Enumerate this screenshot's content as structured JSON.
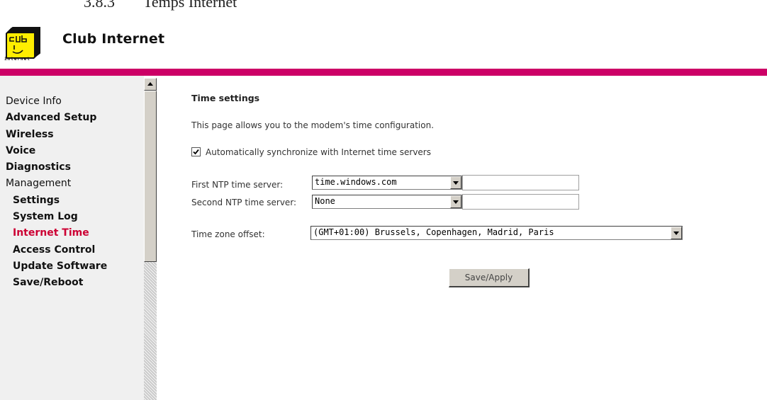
{
  "doc": {
    "section_number": "3.8.3",
    "section_title": "Temps Internet"
  },
  "brand": {
    "name": "Club Internet",
    "logo_small_text": "internet"
  },
  "sidebar": {
    "items": [
      {
        "label": "Device Info",
        "name": "sidebar-item-device-info"
      },
      {
        "label": "Advanced Setup",
        "name": "sidebar-item-advanced-setup"
      },
      {
        "label": "Wireless",
        "name": "sidebar-item-wireless"
      },
      {
        "label": "Voice",
        "name": "sidebar-item-voice"
      },
      {
        "label": "Diagnostics",
        "name": "sidebar-item-diagnostics"
      },
      {
        "label": "Management",
        "name": "sidebar-item-management"
      },
      {
        "label": "Settings",
        "name": "sidebar-item-settings"
      },
      {
        "label": "System Log",
        "name": "sidebar-item-system-log"
      },
      {
        "label": "Internet Time",
        "name": "sidebar-item-internet-time"
      },
      {
        "label": "Access Control",
        "name": "sidebar-item-access-control"
      },
      {
        "label": "Update Software",
        "name": "sidebar-item-update-software"
      },
      {
        "label": "Save/Reboot",
        "name": "sidebar-item-save-reboot"
      }
    ],
    "active": "Internet Time"
  },
  "main": {
    "title": "Time settings",
    "description": "This page allows you to the modem's time configuration.",
    "auto_sync": {
      "label": "Automatically synchronize with Internet time servers",
      "checked": true
    },
    "ntp1": {
      "label": "First NTP time server:",
      "value": "time.windows.com",
      "other": ""
    },
    "ntp2": {
      "label": "Second NTP time server:",
      "value": "None",
      "other": ""
    },
    "timezone": {
      "label": "Time zone offset:",
      "value": "(GMT+01:00) Brussels, Copenhagen, Madrid, Paris"
    },
    "save_label": "Save/Apply"
  },
  "colors": {
    "accent_bar": "#cc0066",
    "active_nav": "#cc0033",
    "logo_yellow": "#ffee00"
  }
}
